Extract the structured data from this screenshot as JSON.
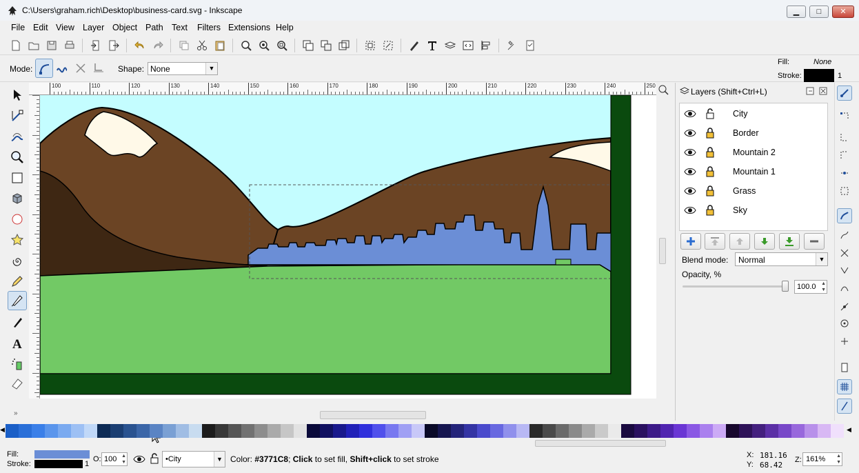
{
  "window": {
    "title": "C:\\Users\\graham.rich\\Desktop\\business-card.svg - Inkscape",
    "minimize": "▁",
    "maximize": "□",
    "close": "✕"
  },
  "menu": [
    "File",
    "Edit",
    "View",
    "Layer",
    "Object",
    "Path",
    "Text",
    "Filters",
    "Extensions",
    "Help"
  ],
  "controls": {
    "mode_label": "Mode:",
    "shape_label": "Shape:",
    "shape_value": "None",
    "fill_label": "Fill:",
    "fill_value": "None",
    "stroke_label": "Stroke:",
    "stroke_width": "1"
  },
  "ruler": {
    "ticks": [
      "100",
      "110",
      "120",
      "130",
      "140",
      "150",
      "160",
      "170",
      "180",
      "190",
      "200",
      "210",
      "220",
      "230",
      "240",
      "250"
    ]
  },
  "layers": {
    "title": "Layers (Shift+Ctrl+L)",
    "items": [
      {
        "label": "City",
        "locked": false
      },
      {
        "label": "Border",
        "locked": true
      },
      {
        "label": "Mountain 2",
        "locked": true
      },
      {
        "label": "Mountain 1",
        "locked": true
      },
      {
        "label": "Grass",
        "locked": true
      },
      {
        "label": "Sky",
        "locked": true
      }
    ],
    "blend_label": "Blend mode:",
    "blend_value": "Normal",
    "opacity_label": "Opacity, %",
    "opacity_value": "100.0",
    "opacity_fraction": 1.0
  },
  "status": {
    "fill_label": "Fill:",
    "stroke_label": "Stroke:",
    "stroke_width": "1",
    "opacity_label": "O:",
    "opacity_value": "100",
    "layer_value": "•City",
    "message_prefix": "Color: ",
    "message_color": "#3771C8",
    "message_sep1": "; ",
    "message_click": "Click",
    "message_mid": " to set fill, ",
    "message_shift": "Shift+click",
    "message_end": " to set stroke",
    "x_label": "X:",
    "x_value": "181.16",
    "y_label": "Y:",
    "y_value": "68.42",
    "zoom_label": "Z:",
    "zoom_value": "161%"
  },
  "colors": {
    "sky": "#c4fdff",
    "grass": "#72c965",
    "mountain": "#6b4424",
    "mountain_dark": "#3e2713",
    "snow": "#fff9e8",
    "border": "#0a4a0e",
    "city": "#6b8ed6",
    "fill_swatch": "#6b8ed6"
  },
  "palette": [
    "#1a5fc7",
    "#2a6fd8",
    "#3a7fe8",
    "#5a95ec",
    "#7aaaf0",
    "#9dc0f4",
    "#c0d8f8",
    "#0d2b55",
    "#1b3e72",
    "#2a5390",
    "#3b66a8",
    "#5a84c4",
    "#7aa0d4",
    "#a0bde4",
    "#c8dcf0",
    "#1c1c1c",
    "#383838",
    "#555555",
    "#717171",
    "#8d8d8d",
    "#aaaaaa",
    "#c6c6c6",
    "#e2e2e2",
    "#0a0a3a",
    "#101060",
    "#18188c",
    "#2020b8",
    "#3030dc",
    "#5050ec",
    "#7878f0",
    "#a0a0f4",
    "#c8c8f8",
    "#0a0a28",
    "#161650",
    "#24247a",
    "#3434a4",
    "#4a4acc",
    "#6868e0",
    "#9090ec",
    "#b8b8f4",
    "#2a2a2a",
    "#4a4a4a",
    "#6a6a6a",
    "#8a8a8a",
    "#aaaaaa",
    "#cacaca",
    "#eaeaea",
    "#1a0a40",
    "#2a1060",
    "#3c1a88",
    "#5024b0",
    "#6a36d4",
    "#8a58e4",
    "#aa80ee",
    "#ccaaf6",
    "#18082e",
    "#2e1258",
    "#44207e",
    "#5c30a6",
    "#7848c8",
    "#9868dc",
    "#b890ea",
    "#d8b8f4",
    "#f0e0fc"
  ]
}
